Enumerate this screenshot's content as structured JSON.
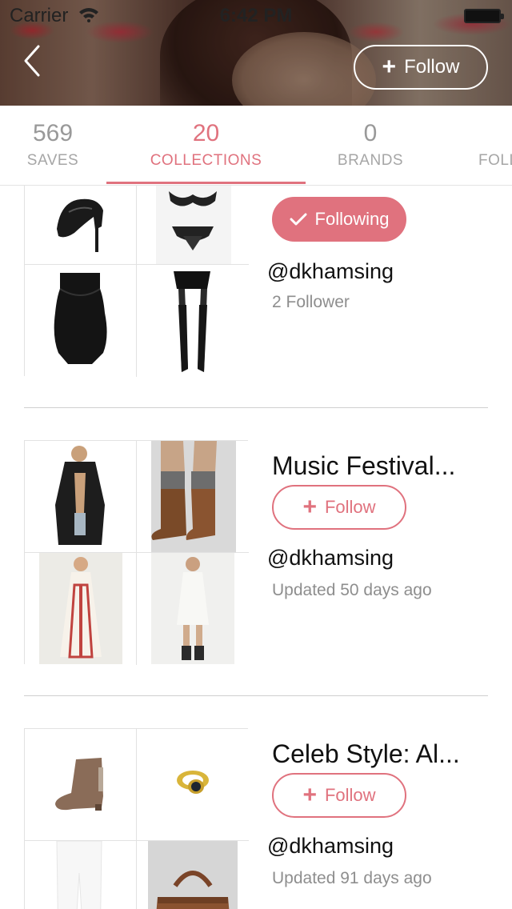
{
  "status_bar": {
    "carrier": "Carrier",
    "time": "6:42 PM"
  },
  "header": {
    "follow_label": "Follow",
    "accent": "#e0727e"
  },
  "tabs": [
    {
      "count": "569",
      "label": "SAVES"
    },
    {
      "count": "20",
      "label": "COLLECTIONS",
      "active": true
    },
    {
      "count": "0",
      "label": "BRANDS"
    },
    {
      "count": "",
      "label": "FOLL"
    }
  ],
  "collections": [
    {
      "title": "",
      "button_label": "Following",
      "button_state": "following",
      "user": "@dkhamsing",
      "meta": "2 Follower",
      "images": [
        "heel-shoe",
        "lingerie-set",
        "black-bodysuit",
        "stockings-garter"
      ]
    },
    {
      "title": "Music Festival...",
      "button_label": "Follow",
      "button_state": "follow",
      "user": "@dkhamsing",
      "meta": "Updated 50 days ago",
      "images": [
        "black-romper",
        "lace-up-boots",
        "boho-maxi-dress",
        "white-sundress"
      ]
    },
    {
      "title": "Celeb Style: Al...",
      "button_label": "Follow",
      "button_state": "follow",
      "user": "@dkhamsing",
      "meta": "Updated 91 days ago",
      "images": [
        "ankle-boot",
        "gold-ring",
        "white-jeans",
        "leather-bag"
      ]
    }
  ]
}
